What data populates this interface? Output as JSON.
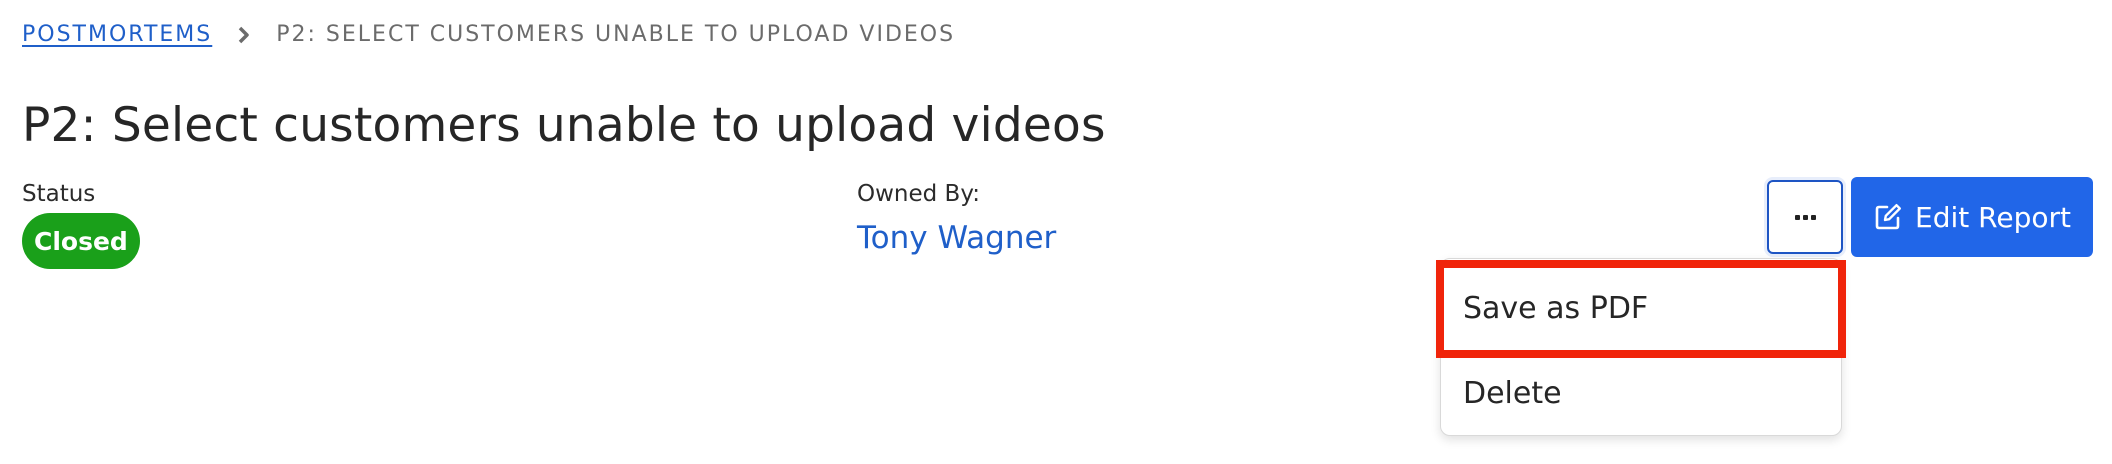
{
  "breadcrumb": {
    "parent": "POSTMORTEMS",
    "current": "P2: SELECT CUSTOMERS UNABLE TO UPLOAD VIDEOS"
  },
  "title": "P2: Select customers unable to upload videos",
  "status": {
    "label": "Status",
    "value": "Closed",
    "color": "#1aa01a"
  },
  "owner": {
    "label": "Owned By:",
    "name": "Tony Wagner"
  },
  "actions": {
    "more_icon": "ellipsis-icon",
    "edit_label": "Edit Report",
    "edit_icon": "edit-icon"
  },
  "menu": {
    "items": [
      {
        "label": "Save as PDF",
        "highlighted": true
      },
      {
        "label": "Delete"
      }
    ]
  },
  "colors": {
    "accent": "#2166e8",
    "link": "#1f5fc9",
    "highlight": "#f0240a"
  }
}
